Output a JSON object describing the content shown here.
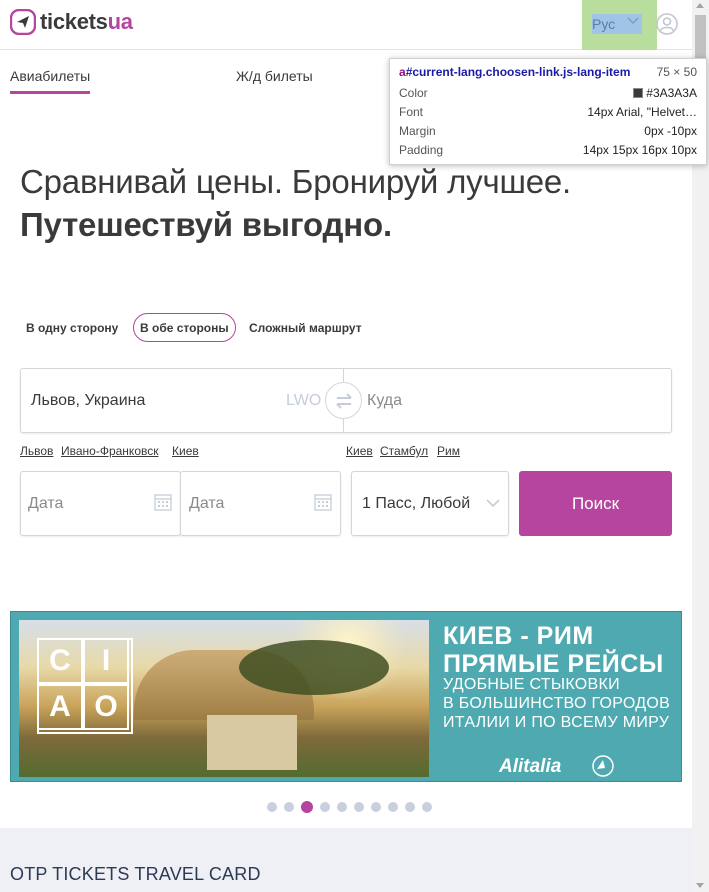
{
  "header": {
    "logo_text_main": "tickets",
    "logo_text_accent": "ua",
    "lang_label": "Рус"
  },
  "tabs": [
    {
      "label": "Авиабилеты",
      "active": true
    },
    {
      "label": "Ж/д билеты",
      "active": false
    }
  ],
  "inspector": {
    "tag": "a",
    "selector": "#current-lang.choosen-link.js-lang-item",
    "size": "75 × 50",
    "rows": [
      {
        "label": "Color",
        "value": "#3A3A3A"
      },
      {
        "label": "Font",
        "value": "14px Arial, \"Helvet…"
      },
      {
        "label": "Margin",
        "value": "0px -10px"
      },
      {
        "label": "Padding",
        "value": "14px 15px 16px 10px"
      }
    ]
  },
  "hero": {
    "line1": "Сравнивай цены. Бронируй лучшее.",
    "line2": "Путешествуй выгодно."
  },
  "trip_types": [
    {
      "label": "В одну сторону",
      "active": false
    },
    {
      "label": "В обе стороны",
      "active": true
    },
    {
      "label": "Сложный маршрут",
      "active": false
    }
  ],
  "search": {
    "from_value": "Львов, Украина",
    "from_iata": "LWO",
    "to_placeholder": "Куда",
    "depart_placeholder": "Дата",
    "return_placeholder": "Дата",
    "passengers_value": "1 Пасс, Любой",
    "submit_label": "Поиск",
    "from_quick": [
      "Львов",
      "Ивано-Франковск",
      "Киев"
    ],
    "to_quick": [
      "Киев",
      "Стамбул",
      "Рим"
    ]
  },
  "banner": {
    "title1": "КИЕВ - РИМ",
    "title2": "ПРЯМЫЕ РЕЙСЫ",
    "sub1": "УДОБНЫЕ СТЫКОВКИ",
    "sub2": "В БОЛЬШИНСТВО ГОРОДОВ",
    "sub3": "ИТАЛИИ И ПО ВСЕМУ МИРУ",
    "ciao": [
      "C",
      "I",
      "A",
      "O"
    ],
    "airline": "Alitalia"
  },
  "carousel": {
    "count": 10,
    "active_index": 2
  },
  "footer_section_title": "OTP TICKETS TRAVEL CARD",
  "colors": {
    "accent": "#b5459f",
    "text": "#3a3a3a",
    "banner": "#4eaab0"
  }
}
